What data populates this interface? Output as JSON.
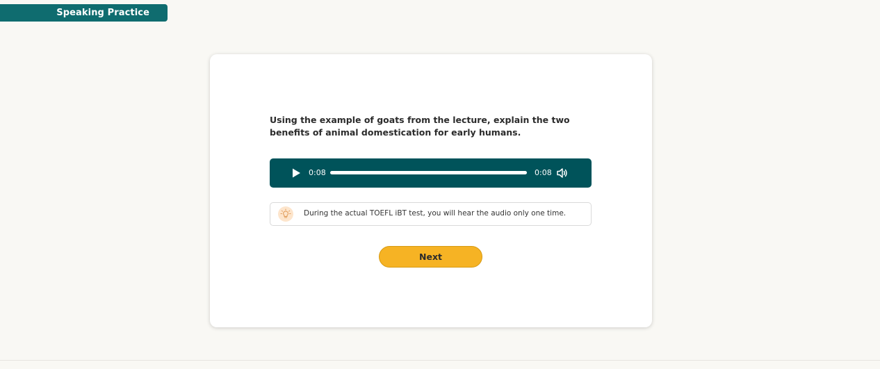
{
  "header": {
    "title": "Speaking Practice"
  },
  "question": {
    "prompt": "Using the example of goats from the lecture, explain the two benefits of animal domestication for early humans."
  },
  "audio_player": {
    "current_time": "0:08",
    "total_time": "0:08",
    "progress_fraction": 1.0,
    "play_icon": "play-icon",
    "volume_icon": "volume-icon",
    "background_color": "#00535a"
  },
  "notice": {
    "icon": "lightbulb-icon",
    "text": "During the actual TOEFL iBT test, you will hear the audio only one time."
  },
  "actions": {
    "next_label": "Next",
    "next_color": "#f6b324"
  },
  "colors": {
    "header_bg": "#0f6c6f",
    "page_bg": "#f9f8f4"
  }
}
